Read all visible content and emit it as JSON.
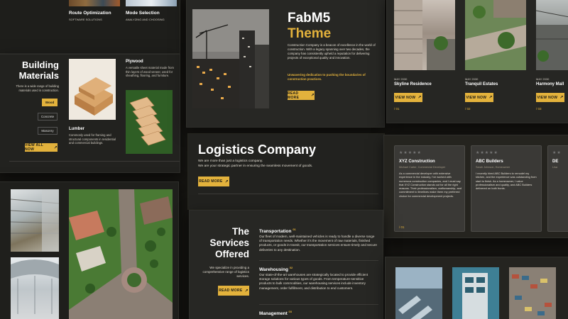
{
  "top_left": {
    "route_title": "Route Optimization",
    "route_sub": "SOFTWARE SOLUTIONS",
    "mode_title": "Mode Selection",
    "mode_sub": "ANALYZING AND CHOOSING"
  },
  "building": {
    "title_line1": "Building",
    "title_line2": "Materials",
    "desc": "There is a wide range of building materials used in construction.",
    "tags": [
      "Wood",
      "Concrete",
      "Masonry"
    ],
    "view_all": "VIEW ALL NOW",
    "plywood_title": "Plywood",
    "plywood_desc": "A versatile sheet material made from thin layers of wood veneer, used for sheathing, flooring, and furniture.",
    "lumber_title": "Lumber",
    "lumber_desc": "Commonly used for framing and structural components in residential and commercial buildings."
  },
  "fab": {
    "title": "FabM5",
    "subtitle": "Theme",
    "desc": "Construction Company is a beacon of excellence in the world of construction. With a legacy spanning over two decades, the company has consistently upheld a reputation for delivering projects of exceptional quality and innovation.",
    "highlight": "Unwavering dedication to pushing the boundaries of construction practices.",
    "read_more": "READ MORE"
  },
  "projects": [
    {
      "date": "MAY 2030",
      "name": "Skyline Residence",
      "btn": "VIEW NOW",
      "num": "/ 01"
    },
    {
      "date": "MAY 2030",
      "name": "Tranquil Estates",
      "btn": "VIEW NOW",
      "num": "/ 02"
    },
    {
      "date": "MAY 2030",
      "name": "Harmony Mall",
      "btn": "VIEW NOW",
      "num": "/ 03"
    }
  ],
  "logistics": {
    "title": "Logistics Company",
    "line1": "We are more than just a logistics company.",
    "line2": "We are your strategic partner in ensuring the seamless movement of goods.",
    "read_more": "READ MORE"
  },
  "testimonials": [
    {
      "stars": "★★★★★",
      "name": "XYZ Construction",
      "role": "Michael Carter, Commercial Developer",
      "text": "As a commercial developer with extensive experience in the industry, I've worked with numerous construction companies, and I must say that XYZ Construction stands out for all the right reasons. Their professionalism, craftsmanship, and commitment to timelines make them my preferred choice for commercial development projects.",
      "num": "/ 01"
    },
    {
      "stars": "★★★★★",
      "name": "ABC Builders",
      "role": "Sarah Johnson, Homeowner",
      "text": "I recently hired ABC Builders to remodel my kitchen, and the experience was outstanding from start to finish. As a homeowner, I value professionalism and quality, and ABC Builders delivered on both fronts.",
      "num": "/ 02"
    },
    {
      "stars": "★★",
      "name": "DE",
      "role": "Lisa",
      "text": "",
      "num": ""
    }
  ],
  "services": {
    "title_line1": "The",
    "title_line2": "Services",
    "title_line3": "Offered",
    "desc": "We specialize in providing a comprehensive range of logistics services.",
    "read_more": "READ MORE",
    "items": [
      {
        "title": "Transportation",
        "num": "01",
        "desc": "Our fleet of modern, well-maintained vehicles is ready to handle a diverse range of transportation needs. Whether it's the movement of raw materials, finished products, or goods in transit, our transportation services ensure timely and secure deliveries to any destination."
      },
      {
        "title": "Warehousing",
        "num": "02",
        "desc": "Our state-of-the-art warehouses are strategically located to provide efficient storage solutions for various types of goods. From temperature-sensitive products to bulk commodities, our warehousing services include inventory management, order fulfillment, and distribution to end customers."
      },
      {
        "title": "Management",
        "num": "03",
        "desc": ""
      }
    ]
  }
}
